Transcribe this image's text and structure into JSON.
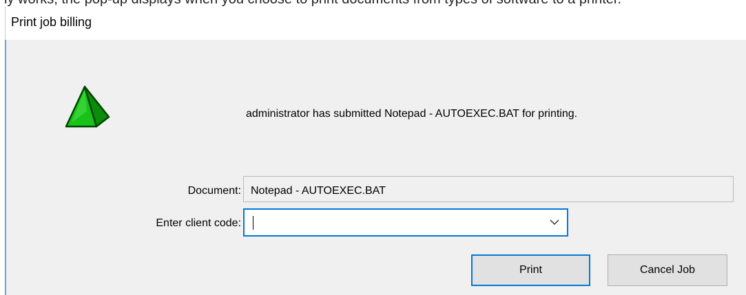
{
  "dialog": {
    "title": "Print job billing",
    "message": "administrator has submitted Notepad - AUTOEXEC.BAT for printing.",
    "icon": "warning-triangle-icon"
  },
  "form": {
    "document_label": "Document:",
    "document_value": "Notepad - AUTOEXEC.BAT",
    "client_code_label": "Enter client code:",
    "client_code_value": ""
  },
  "buttons": {
    "print_label": "Print",
    "cancel_label": "Cancel Job"
  },
  "colors": {
    "accent": "#0078d7",
    "icon_green": "#19c219",
    "dialog_bg": "#f0f0f0"
  }
}
